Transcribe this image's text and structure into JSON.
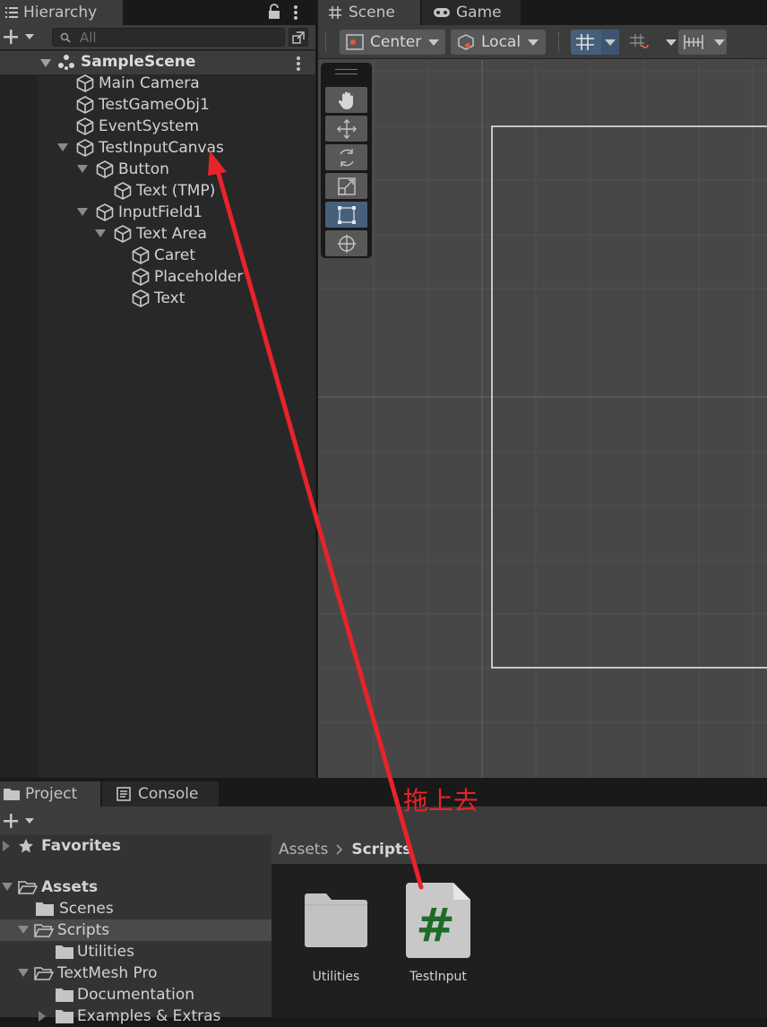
{
  "hierarchy": {
    "tab_label": "Hierarchy",
    "search_placeholder": "All",
    "scene_name": "SampleScene",
    "items": [
      {
        "label": "Main Camera"
      },
      {
        "label": "TestGameObj1"
      },
      {
        "label": "EventSystem"
      },
      {
        "label": "TestInputCanvas"
      },
      {
        "label": "Button"
      },
      {
        "label": "Text (TMP)"
      },
      {
        "label": "InputField1"
      },
      {
        "label": "Text Area"
      },
      {
        "label": "Caret"
      },
      {
        "label": "Placeholder"
      },
      {
        "label": "Text"
      }
    ]
  },
  "scene_view": {
    "tabs": [
      "Scene",
      "Game"
    ],
    "pivot_label": "Center",
    "space_label": "Local"
  },
  "project": {
    "tabs": [
      "Project",
      "Console"
    ],
    "tree": [
      {
        "label": "Favorites"
      },
      {
        "label": "Assets"
      },
      {
        "label": "Scenes"
      },
      {
        "label": "Scripts"
      },
      {
        "label": "Utilities"
      },
      {
        "label": "TextMesh Pro"
      },
      {
        "label": "Documentation"
      },
      {
        "label": "Examples & Extras"
      }
    ],
    "breadcrumb": [
      "Assets",
      "Scripts"
    ],
    "assets": [
      {
        "label": "Utilities",
        "icon": "folder-icon"
      },
      {
        "label": "TestInput",
        "icon": "csharp-script-icon"
      }
    ]
  },
  "annotation": {
    "text": "拖上去",
    "color": "#e8232b"
  }
}
